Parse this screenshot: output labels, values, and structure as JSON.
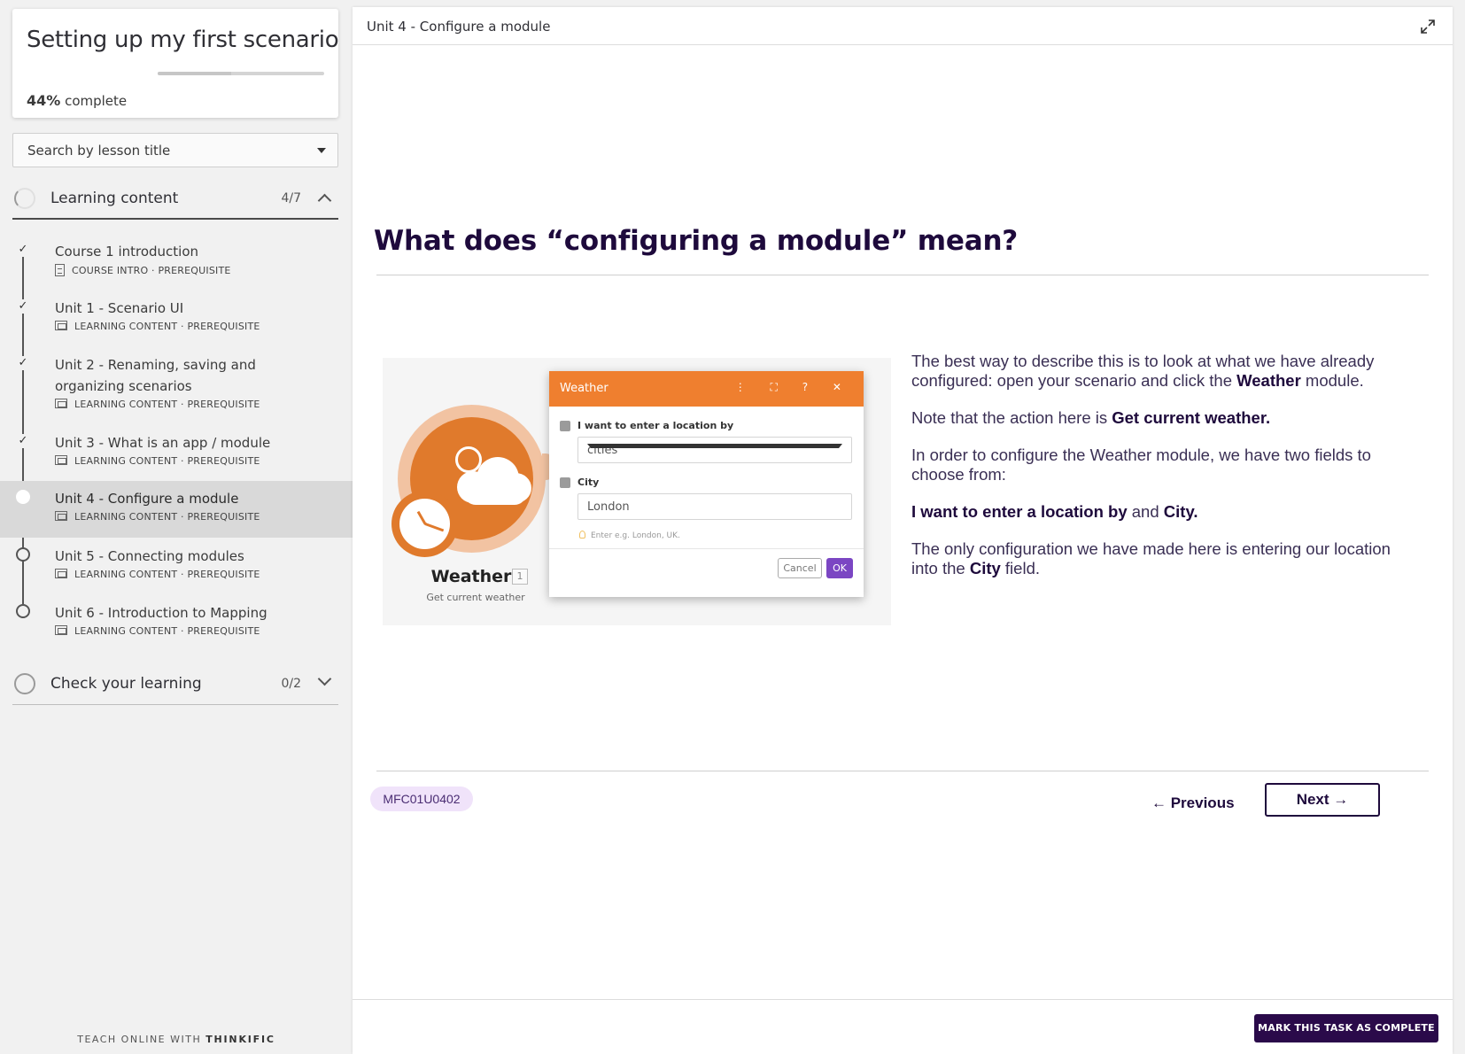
{
  "sidebar": {
    "course_title": "Setting up my first scenario",
    "progress": {
      "percent_label": "44%",
      "suffix": "complete",
      "fraction": 0.44
    },
    "search": {
      "label": "Search by lesson title"
    },
    "chapters": [
      {
        "title": "Learning content",
        "count": "4/7",
        "expanded": true,
        "lessons": [
          {
            "title": "Course 1 introduction",
            "type": "COURSE INTRO",
            "tag": "PREREQUISITE",
            "status": "completed",
            "icon": "document-icon"
          },
          {
            "title": "Unit 1 - Scenario UI",
            "type": "LEARNING CONTENT",
            "tag": "PREREQUISITE",
            "status": "completed",
            "icon": "slides-icon"
          },
          {
            "title": "Unit 2 - Renaming, saving and organizing scenarios",
            "type": "LEARNING CONTENT",
            "tag": "PREREQUISITE",
            "status": "completed",
            "icon": "slides-icon"
          },
          {
            "title": "Unit 3 - What is an app / module",
            "type": "LEARNING CONTENT",
            "tag": "PREREQUISITE",
            "status": "completed",
            "icon": "slides-icon"
          },
          {
            "title": "Unit 4 - Configure a module",
            "type": "LEARNING CONTENT",
            "tag": "PREREQUISITE",
            "status": "current",
            "icon": "slides-icon"
          },
          {
            "title": "Unit 5 - Connecting modules",
            "type": "LEARNING CONTENT",
            "tag": "PREREQUISITE",
            "status": "not-started",
            "icon": "slides-icon"
          },
          {
            "title": "Unit 6 - Introduction to Mapping",
            "type": "LEARNING CONTENT",
            "tag": "PREREQUISITE",
            "status": "not-started",
            "icon": "slides-icon"
          }
        ]
      },
      {
        "title": "Check your learning",
        "count": "0/2",
        "expanded": false
      }
    ],
    "footer": {
      "prefix": "TEACH ONLINE WITH",
      "brand": "THINKIFIC"
    }
  },
  "main": {
    "header_title": "Unit 4 - Configure a module",
    "heading": "What does “configuring a module” mean?",
    "illustration": {
      "module_name": "Weather",
      "module_badge": "1",
      "module_subtitle": "Get current weather",
      "dialog_title": "Weather",
      "dialog_icons": "⋮ ⛶ ? ✕",
      "field1_label": "I want to enter a location by",
      "field1_value": "cities",
      "field2_label": "City",
      "field2_value": "London",
      "hint": "Enter e.g. London, UK.",
      "cancel": "Cancel",
      "ok": "OK"
    },
    "paragraphs": {
      "p1_a": "The best way to describe this is to look at what we have already configured: open your scenario and click the ",
      "p1_b": "Weather",
      "p1_c": " module.",
      "p2_a": "Note that the action here is ",
      "p2_b": "Get current weather.",
      "p3": "In order to configure the Weather module, we have two fields to choose from:",
      "p4_a": "I want to enter a location by",
      "p4_b": " and ",
      "p4_c": "City.",
      "p5_a": "The only configuration we have made here is entering our location into the ",
      "p5_b": "City",
      "p5_c": " field."
    },
    "lesson_code": "MFC01U0402",
    "nav": {
      "previous": "← Previous",
      "next": "Next →"
    },
    "complete_button": "MARK THIS TASK AS COMPLETE →"
  },
  "colors": {
    "brand_dark": "#1e0a3c",
    "accent_orange": "#ef7f2f",
    "badge_bg": "#f0e3fa"
  }
}
